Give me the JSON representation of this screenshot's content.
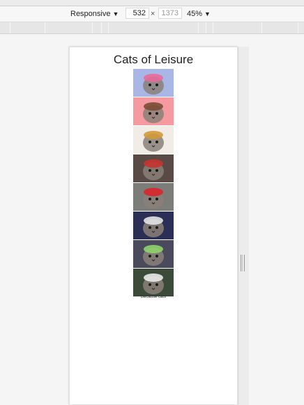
{
  "toolbar": {
    "device_preset": "Responsive",
    "width_value": "532",
    "times_symbol": "×",
    "height_value": "1373",
    "zoom": "45%",
    "dropdown_icon": "triangle-down-icon"
  },
  "page": {
    "title": "Cats of Leisure",
    "caption": "Because cats",
    "images": [
      {
        "name": "cat-pink-boa",
        "bg": "#a9b7e6",
        "accent": "#e86a9a"
      },
      {
        "name": "cat-curly-wig",
        "bg": "#f49aa0",
        "accent": "#7a4d35"
      },
      {
        "name": "cat-lion-mane",
        "bg": "#f1ede6",
        "accent": "#d39a38"
      },
      {
        "name": "cat-mario-hat",
        "bg": "#5a4a45",
        "accent": "#c8322e"
      },
      {
        "name": "cat-striped-hat",
        "bg": "#7c7c78",
        "accent": "#d8262a"
      },
      {
        "name": "cat-necktie",
        "bg": "#2b2f55",
        "accent": "#e4e4e4"
      },
      {
        "name": "cat-green-hat",
        "bg": "#4a4a5c",
        "accent": "#8fd36b"
      },
      {
        "name": "cat-skeleton",
        "bg": "#3c4a3a",
        "accent": "#e9e9e9"
      }
    ]
  },
  "colors": {
    "chrome": "#f7f7f7",
    "viewport": "#f5f5f5",
    "device": "#ffffff"
  }
}
